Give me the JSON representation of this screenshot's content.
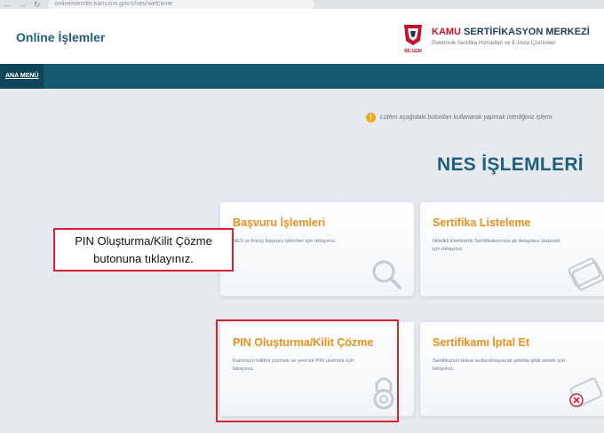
{
  "browser": {
    "nav_glyphs": [
      "←",
      "→",
      "↻"
    ],
    "url": "onlineislemler.kamusm.gov.tr/nes/welcome"
  },
  "header": {
    "site_title": "Online İşlemler",
    "brand_accent": "KAMU",
    "brand_rest": " SERTİFİKASYON MERKEZİ",
    "brand_subtitle": "Elektronik Sertifika Hizmetleri ve E-İmza Çözümleri",
    "logo_caption": "BİLGEM"
  },
  "nav": {
    "main_menu": "ANA MENÜ"
  },
  "notice": {
    "icon": "info-icon",
    "text": "Lütfen aşağıdaki butonları kullanarak yapmak istediğiniz işlemi"
  },
  "section_title": "NES İŞLEMLERİ",
  "cards": [
    {
      "title": "Başvuru İşlemleri",
      "description": "NES (e-İmza) başvuru işlemleri için tıklayınız.",
      "icon": "magnifier-icon"
    },
    {
      "title": "Sertifika Listeleme",
      "description": "Nitelikli Elektronik Sertifikalarınıza ait detaylara ulaşmak için tıklayınız.",
      "icon": "card-icon"
    },
    {
      "title": "PIN Oluşturma/Kilit Çözme",
      "description": "Kartınızın kilidini çözmek ve yeni bir PIN üretmek için tıklayınız.",
      "icon": "padlock-icon"
    },
    {
      "title": "Sertifikamı İptal Et",
      "description": "Sertifikanızı tekrar kullanılmayacak şekilde iptal etmek için tıklayınız.",
      "icon": "cancel-card-icon"
    }
  ],
  "callout": {
    "line1": "PIN Oluşturma/Kilit Çözme",
    "line2": "butonuna tıklayınız."
  },
  "colors": {
    "primary": "#1f5f7d",
    "nav_bar": "#16566e",
    "card_title": "#e9901c",
    "highlight": "#d6232f",
    "brand_red": "#c8102e"
  }
}
